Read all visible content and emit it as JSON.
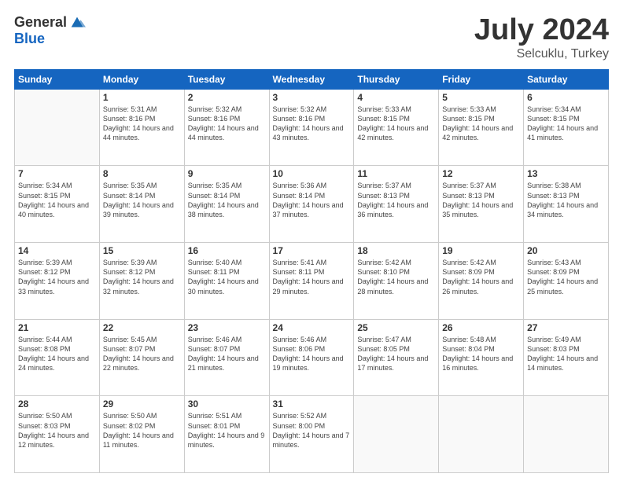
{
  "logo": {
    "general": "General",
    "blue": "Blue",
    "icon_color": "#1a6cb5"
  },
  "header": {
    "title": "July 2024",
    "subtitle": "Selcuklu, Turkey"
  },
  "weekdays": [
    "Sunday",
    "Monday",
    "Tuesday",
    "Wednesday",
    "Thursday",
    "Friday",
    "Saturday"
  ],
  "weeks": [
    [
      {
        "day": "",
        "sunrise": "",
        "sunset": "",
        "daylight": ""
      },
      {
        "day": "1",
        "sunrise": "Sunrise: 5:31 AM",
        "sunset": "Sunset: 8:16 PM",
        "daylight": "Daylight: 14 hours and 44 minutes."
      },
      {
        "day": "2",
        "sunrise": "Sunrise: 5:32 AM",
        "sunset": "Sunset: 8:16 PM",
        "daylight": "Daylight: 14 hours and 44 minutes."
      },
      {
        "day": "3",
        "sunrise": "Sunrise: 5:32 AM",
        "sunset": "Sunset: 8:16 PM",
        "daylight": "Daylight: 14 hours and 43 minutes."
      },
      {
        "day": "4",
        "sunrise": "Sunrise: 5:33 AM",
        "sunset": "Sunset: 8:15 PM",
        "daylight": "Daylight: 14 hours and 42 minutes."
      },
      {
        "day": "5",
        "sunrise": "Sunrise: 5:33 AM",
        "sunset": "Sunset: 8:15 PM",
        "daylight": "Daylight: 14 hours and 42 minutes."
      },
      {
        "day": "6",
        "sunrise": "Sunrise: 5:34 AM",
        "sunset": "Sunset: 8:15 PM",
        "daylight": "Daylight: 14 hours and 41 minutes."
      }
    ],
    [
      {
        "day": "7",
        "sunrise": "Sunrise: 5:34 AM",
        "sunset": "Sunset: 8:15 PM",
        "daylight": "Daylight: 14 hours and 40 minutes."
      },
      {
        "day": "8",
        "sunrise": "Sunrise: 5:35 AM",
        "sunset": "Sunset: 8:14 PM",
        "daylight": "Daylight: 14 hours and 39 minutes."
      },
      {
        "day": "9",
        "sunrise": "Sunrise: 5:35 AM",
        "sunset": "Sunset: 8:14 PM",
        "daylight": "Daylight: 14 hours and 38 minutes."
      },
      {
        "day": "10",
        "sunrise": "Sunrise: 5:36 AM",
        "sunset": "Sunset: 8:14 PM",
        "daylight": "Daylight: 14 hours and 37 minutes."
      },
      {
        "day": "11",
        "sunrise": "Sunrise: 5:37 AM",
        "sunset": "Sunset: 8:13 PM",
        "daylight": "Daylight: 14 hours and 36 minutes."
      },
      {
        "day": "12",
        "sunrise": "Sunrise: 5:37 AM",
        "sunset": "Sunset: 8:13 PM",
        "daylight": "Daylight: 14 hours and 35 minutes."
      },
      {
        "day": "13",
        "sunrise": "Sunrise: 5:38 AM",
        "sunset": "Sunset: 8:13 PM",
        "daylight": "Daylight: 14 hours and 34 minutes."
      }
    ],
    [
      {
        "day": "14",
        "sunrise": "Sunrise: 5:39 AM",
        "sunset": "Sunset: 8:12 PM",
        "daylight": "Daylight: 14 hours and 33 minutes."
      },
      {
        "day": "15",
        "sunrise": "Sunrise: 5:39 AM",
        "sunset": "Sunset: 8:12 PM",
        "daylight": "Daylight: 14 hours and 32 minutes."
      },
      {
        "day": "16",
        "sunrise": "Sunrise: 5:40 AM",
        "sunset": "Sunset: 8:11 PM",
        "daylight": "Daylight: 14 hours and 30 minutes."
      },
      {
        "day": "17",
        "sunrise": "Sunrise: 5:41 AM",
        "sunset": "Sunset: 8:11 PM",
        "daylight": "Daylight: 14 hours and 29 minutes."
      },
      {
        "day": "18",
        "sunrise": "Sunrise: 5:42 AM",
        "sunset": "Sunset: 8:10 PM",
        "daylight": "Daylight: 14 hours and 28 minutes."
      },
      {
        "day": "19",
        "sunrise": "Sunrise: 5:42 AM",
        "sunset": "Sunset: 8:09 PM",
        "daylight": "Daylight: 14 hours and 26 minutes."
      },
      {
        "day": "20",
        "sunrise": "Sunrise: 5:43 AM",
        "sunset": "Sunset: 8:09 PM",
        "daylight": "Daylight: 14 hours and 25 minutes."
      }
    ],
    [
      {
        "day": "21",
        "sunrise": "Sunrise: 5:44 AM",
        "sunset": "Sunset: 8:08 PM",
        "daylight": "Daylight: 14 hours and 24 minutes."
      },
      {
        "day": "22",
        "sunrise": "Sunrise: 5:45 AM",
        "sunset": "Sunset: 8:07 PM",
        "daylight": "Daylight: 14 hours and 22 minutes."
      },
      {
        "day": "23",
        "sunrise": "Sunrise: 5:46 AM",
        "sunset": "Sunset: 8:07 PM",
        "daylight": "Daylight: 14 hours and 21 minutes."
      },
      {
        "day": "24",
        "sunrise": "Sunrise: 5:46 AM",
        "sunset": "Sunset: 8:06 PM",
        "daylight": "Daylight: 14 hours and 19 minutes."
      },
      {
        "day": "25",
        "sunrise": "Sunrise: 5:47 AM",
        "sunset": "Sunset: 8:05 PM",
        "daylight": "Daylight: 14 hours and 17 minutes."
      },
      {
        "day": "26",
        "sunrise": "Sunrise: 5:48 AM",
        "sunset": "Sunset: 8:04 PM",
        "daylight": "Daylight: 14 hours and 16 minutes."
      },
      {
        "day": "27",
        "sunrise": "Sunrise: 5:49 AM",
        "sunset": "Sunset: 8:03 PM",
        "daylight": "Daylight: 14 hours and 14 minutes."
      }
    ],
    [
      {
        "day": "28",
        "sunrise": "Sunrise: 5:50 AM",
        "sunset": "Sunset: 8:03 PM",
        "daylight": "Daylight: 14 hours and 12 minutes."
      },
      {
        "day": "29",
        "sunrise": "Sunrise: 5:50 AM",
        "sunset": "Sunset: 8:02 PM",
        "daylight": "Daylight: 14 hours and 11 minutes."
      },
      {
        "day": "30",
        "sunrise": "Sunrise: 5:51 AM",
        "sunset": "Sunset: 8:01 PM",
        "daylight": "Daylight: 14 hours and 9 minutes."
      },
      {
        "day": "31",
        "sunrise": "Sunrise: 5:52 AM",
        "sunset": "Sunset: 8:00 PM",
        "daylight": "Daylight: 14 hours and 7 minutes."
      },
      {
        "day": "",
        "sunrise": "",
        "sunset": "",
        "daylight": ""
      },
      {
        "day": "",
        "sunrise": "",
        "sunset": "",
        "daylight": ""
      },
      {
        "day": "",
        "sunrise": "",
        "sunset": "",
        "daylight": ""
      }
    ]
  ]
}
